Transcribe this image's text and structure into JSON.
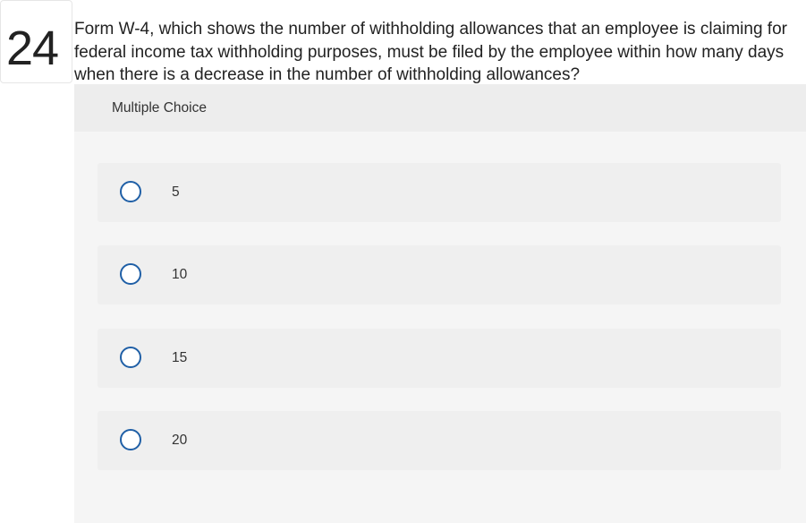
{
  "question": {
    "number": "24",
    "text": "Form W-4, which shows the number of withholding allowances that an employee is claiming for federal income tax withholding purposes, must be filed by the employee within how many days when there is a decrease in the number of withholding allowances?"
  },
  "panel": {
    "header": "Multiple Choice"
  },
  "choices": [
    {
      "label": "5"
    },
    {
      "label": "10"
    },
    {
      "label": "15"
    },
    {
      "label": "20"
    }
  ],
  "colors": {
    "radio_border": "#1f5fa6",
    "panel_bg": "#f3f3f3",
    "choice_bg": "#efefef"
  },
  "icons": {
    "radio": "radio-unselected-icon"
  }
}
